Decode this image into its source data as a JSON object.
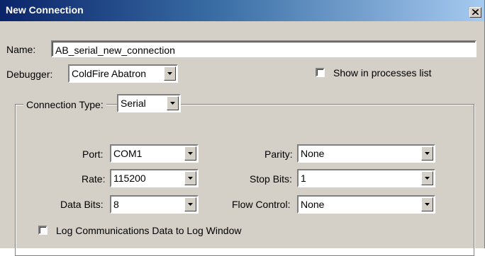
{
  "window": {
    "title": "New Connection"
  },
  "name_field": {
    "label": "Name:",
    "value": "AB_serial_new_connection"
  },
  "debugger": {
    "label": "Debugger:",
    "value": "ColdFire Abatron"
  },
  "show_in_processes": {
    "label": "Show in processes list",
    "checked": false
  },
  "connection_type": {
    "label": "Connection Type:",
    "value": "Serial"
  },
  "port": {
    "label": "Port:",
    "value": "COM1"
  },
  "rate": {
    "label": "Rate:",
    "value": "115200"
  },
  "data_bits": {
    "label": "Data Bits:",
    "value": "8"
  },
  "parity": {
    "label": "Parity:",
    "value": "None"
  },
  "stop_bits": {
    "label": "Stop Bits:",
    "value": "1"
  },
  "flow_control": {
    "label": "Flow Control:",
    "value": "None"
  },
  "log_comm": {
    "label": "Log Communications Data to Log Window",
    "checked": false
  },
  "colors": {
    "title_start": "#0a246a",
    "title_end": "#a6caf0",
    "face": "#d4d0c8"
  },
  "icons": {
    "close": "close-icon",
    "dropdown": "chevron-down-icon"
  }
}
